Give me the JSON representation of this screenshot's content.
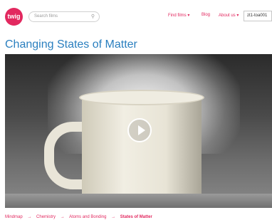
{
  "header": {
    "logo_text": "twig",
    "search_placeholder": "Search films",
    "nav": [
      "Find films",
      "Blog",
      "About us"
    ],
    "code_value": "zt1-toa001"
  },
  "page_title": "Changing States of Matter",
  "breadcrumb": [
    "Mindmap",
    "Chemistry",
    "Atoms and Bonding",
    "States of Matter"
  ],
  "colors": {
    "brand": "#e2285f",
    "title": "#2a7fbf"
  }
}
